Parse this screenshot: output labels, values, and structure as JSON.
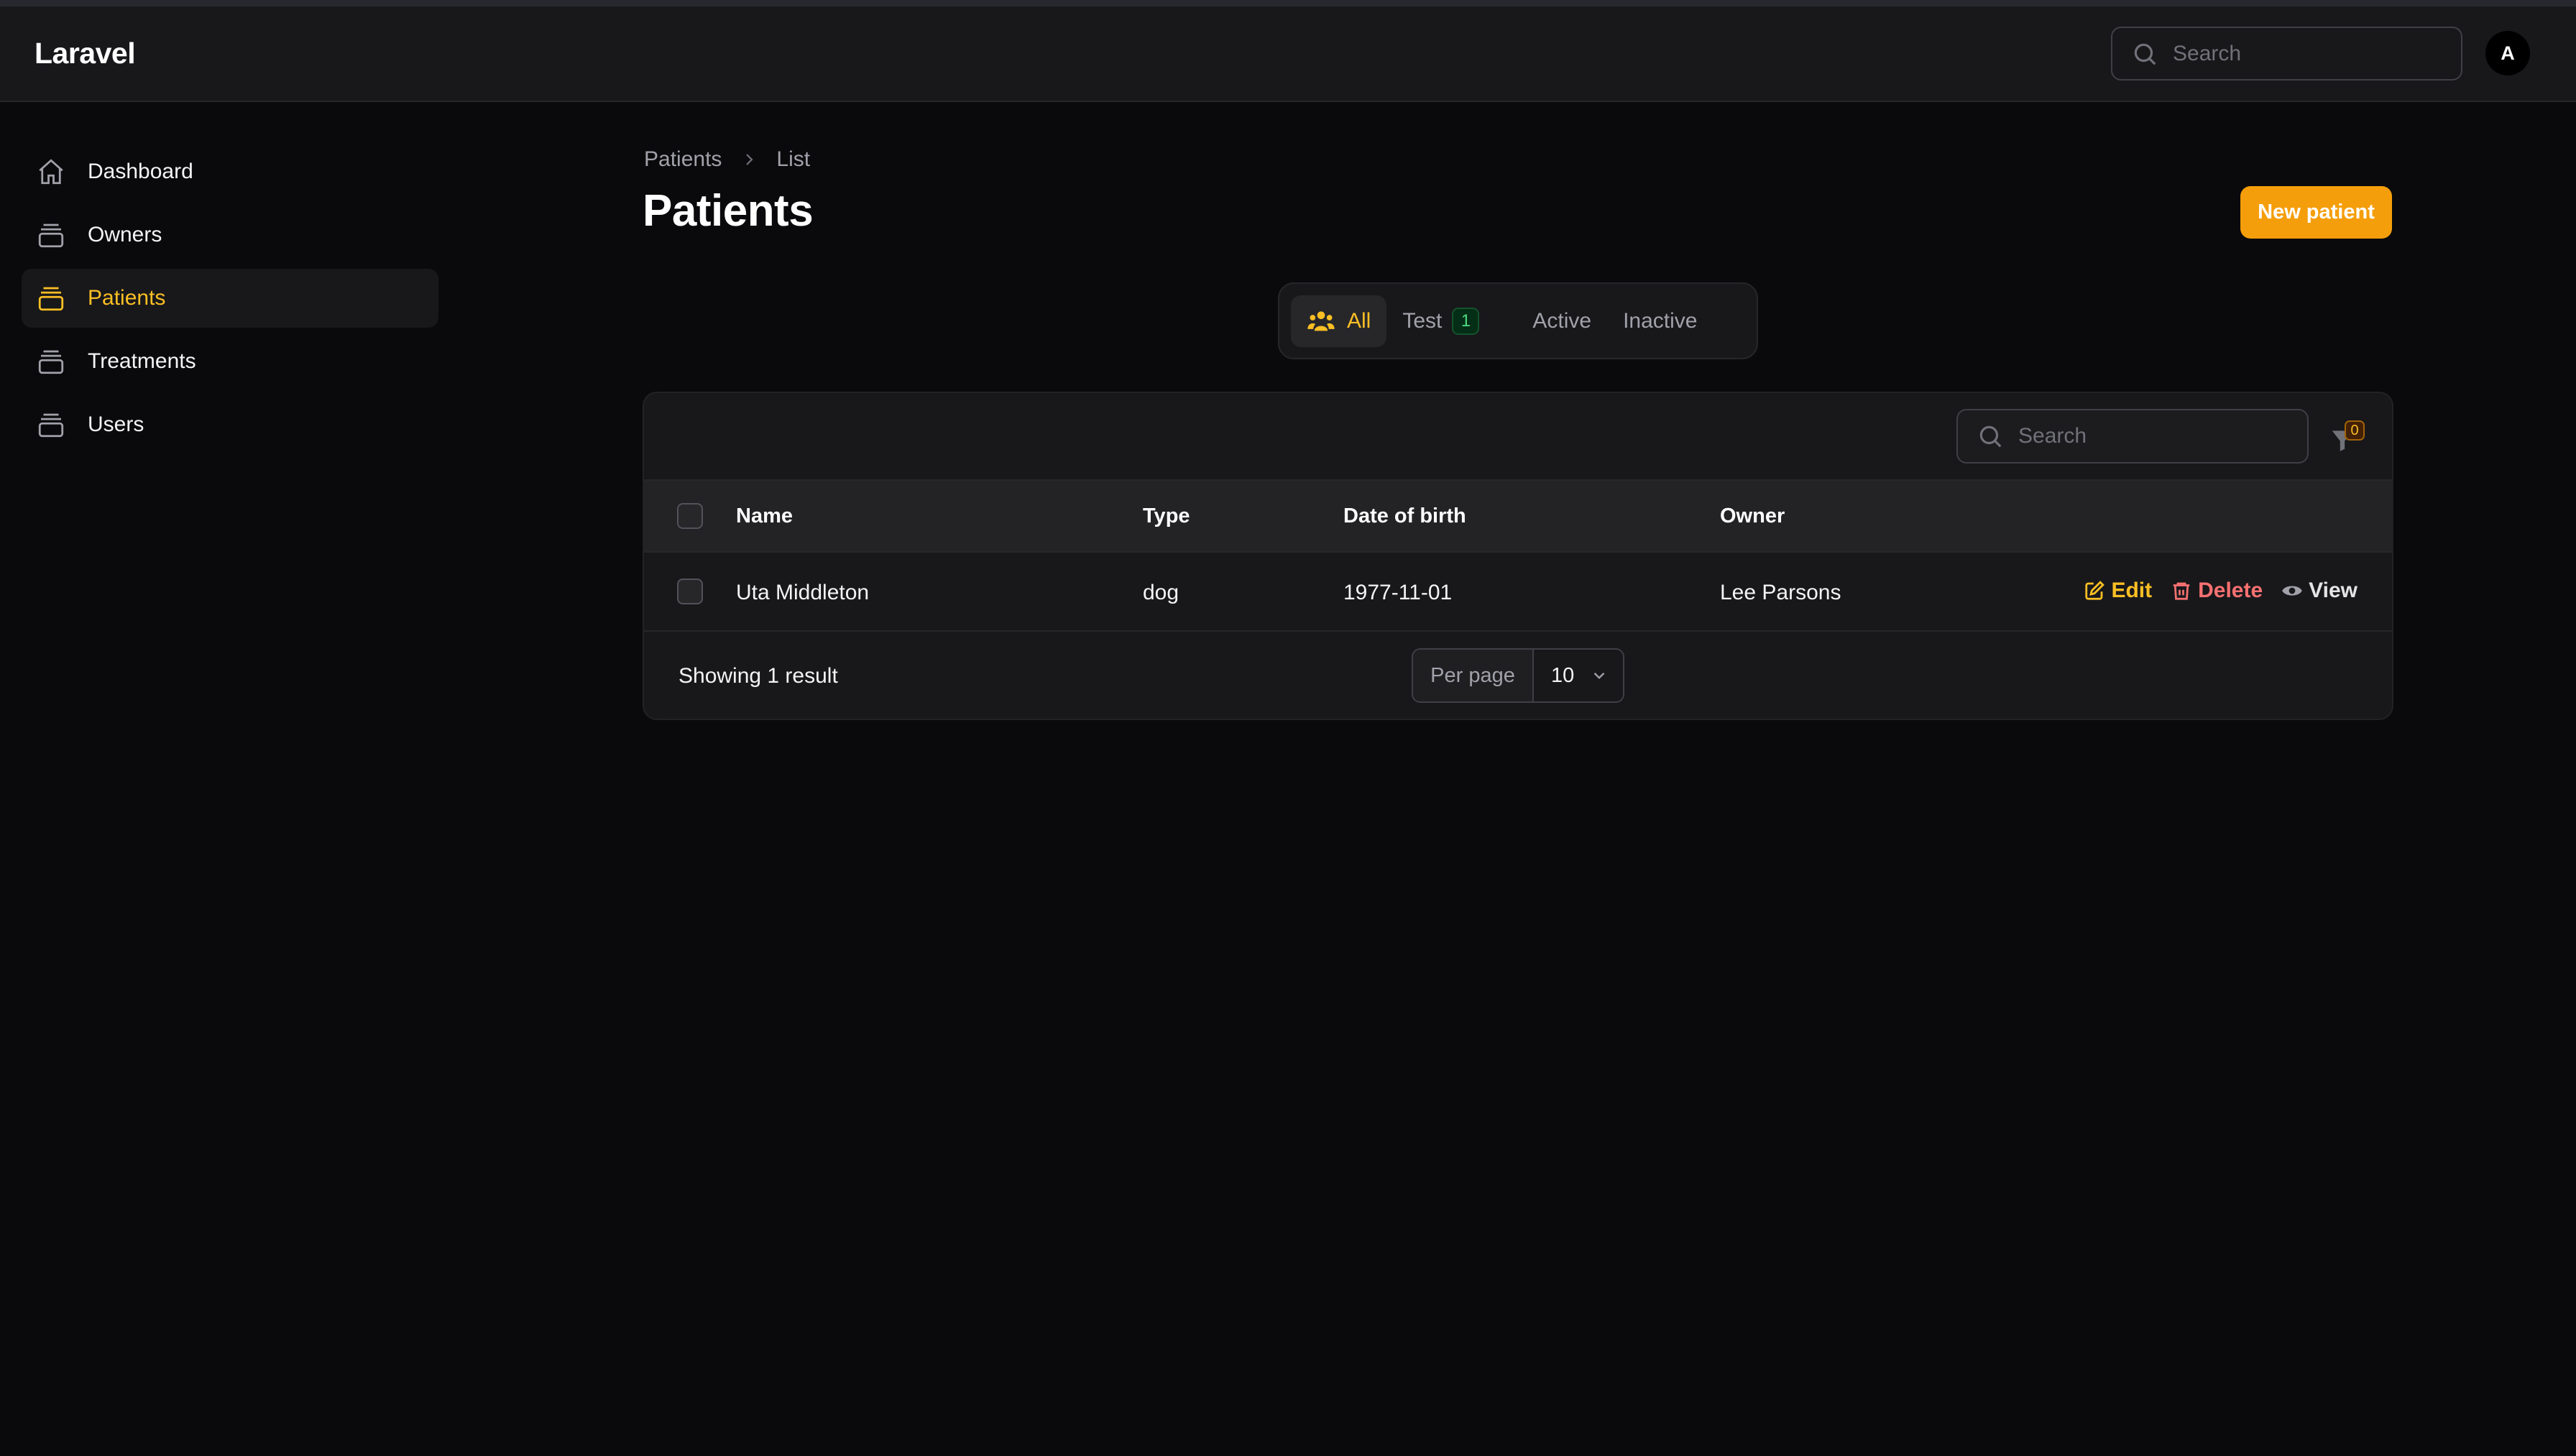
{
  "app": {
    "brand": "Laravel"
  },
  "header": {
    "search_placeholder": "Search",
    "avatar_initial": "A"
  },
  "sidebar": {
    "items": [
      {
        "label": "Dashboard",
        "icon": "home-icon",
        "active": false
      },
      {
        "label": "Owners",
        "icon": "collection-icon",
        "active": false
      },
      {
        "label": "Patients",
        "icon": "collection-icon",
        "active": true
      },
      {
        "label": "Treatments",
        "icon": "collection-icon",
        "active": false
      },
      {
        "label": "Users",
        "icon": "collection-icon",
        "active": false
      }
    ]
  },
  "breadcrumb": {
    "parent": "Patients",
    "current": "List"
  },
  "page": {
    "title": "Patients",
    "new_button": "New patient"
  },
  "tabs": [
    {
      "label": "All",
      "icon": "users-icon",
      "active": true
    },
    {
      "label": "Test",
      "badge": "1"
    },
    {
      "label": "Active"
    },
    {
      "label": "Inactive"
    }
  ],
  "table": {
    "search_placeholder": "Search",
    "filter_count": "0",
    "columns": [
      "Name",
      "Type",
      "Date of birth",
      "Owner"
    ],
    "rows": [
      {
        "name": "Uta Middleton",
        "type": "dog",
        "dob": "1977-11-01",
        "owner": "Lee Parsons"
      }
    ],
    "actions": {
      "edit": "Edit",
      "delete": "Delete",
      "view": "View"
    },
    "footer": {
      "showing": "Showing 1 result",
      "per_page_label": "Per page",
      "per_page_value": "10"
    }
  },
  "colors": {
    "accent": "#f59e0b",
    "accent_text": "#fbbf24",
    "danger": "#f87171",
    "background": "#0a0a0c",
    "surface": "#18181b"
  }
}
